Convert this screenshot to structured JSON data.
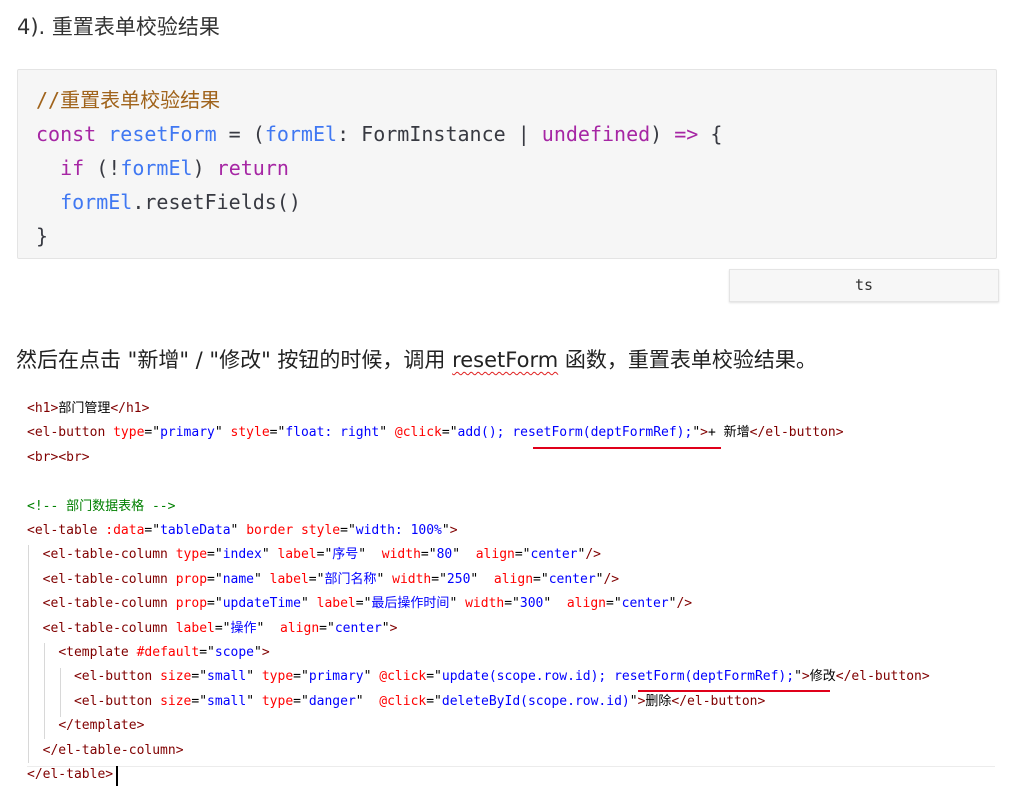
{
  "heading": "4). 重置表单校验结果",
  "code_block": {
    "lang": "ts",
    "lines": [
      "//重置表单校验结果",
      "const resetForm = (formEl: FormInstance | undefined) => {",
      "  if (!formEl) return",
      "  formEl.resetFields()",
      "}"
    ]
  },
  "paragraph": {
    "before": "然后在点击 \"新增\" / \"修改\" 按钮的时候，调用 ",
    "highlight": "resetForm",
    "after": " 函数，重置表单校验结果。"
  },
  "screenshot_code": {
    "lines": [
      "<h1>部门管理</h1>",
      "<el-button type=\"primary\" style=\"float: right\" @click=\"add(); resetForm(deptFormRef);\">+ 新增</el-button>",
      "<br><br>",
      "",
      "<!-- 部门数据表格 -->",
      "<el-table :data=\"tableData\" border style=\"width: 100%\">",
      "  <el-table-column type=\"index\" label=\"序号\"  width=\"80\"  align=\"center\"/>",
      "  <el-table-column prop=\"name\" label=\"部门名称\" width=\"250\"  align=\"center\"/>",
      "  <el-table-column prop=\"updateTime\" label=\"最后操作时间\" width=\"300\"  align=\"center\"/>",
      "  <el-table-column label=\"操作\"  align=\"center\">",
      "    <template #default=\"scope\">",
      "      <el-button size=\"small\" type=\"primary\" @click=\"update(scope.row.id); resetForm(deptFormRef);\">修改</el-button>",
      "      <el-button size=\"small\" type=\"danger\"  @click=\"deleteById(scope.row.id)\">删除</el-button>",
      "    </template>",
      "  </el-table-column>",
      "</el-table>"
    ]
  },
  "colors": {
    "highlight_underline": "#e0001a",
    "code_bg": "#f6f6f6"
  }
}
